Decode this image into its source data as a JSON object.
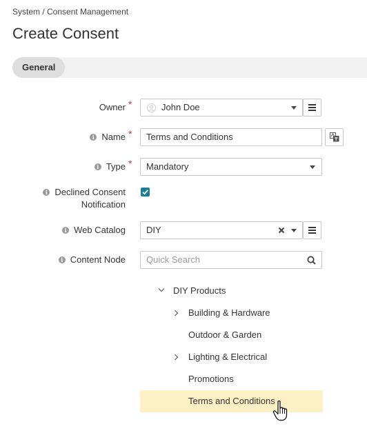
{
  "breadcrumb": "System / Consent Management",
  "page_title": "Create Consent",
  "tabs": [
    {
      "label": "General"
    }
  ],
  "form": {
    "owner": {
      "label": "Owner",
      "value": "John Doe"
    },
    "name": {
      "label": "Name",
      "value": "Terms and Conditions"
    },
    "type": {
      "label": "Type",
      "value": "Mandatory"
    },
    "declined": {
      "label_line1": "Declined Consent",
      "label_line2": "Notification",
      "checked": true
    },
    "web_catalog": {
      "label": "Web Catalog",
      "value": "DIY"
    },
    "content_node": {
      "label": "Content Node",
      "placeholder": "Quick Search"
    }
  },
  "tree": {
    "root": "DIY Products",
    "children": [
      {
        "label": "Building & Hardware",
        "expandable": true
      },
      {
        "label": "Outdoor & Garden",
        "expandable": false
      },
      {
        "label": "Lighting & Electrical",
        "expandable": true
      },
      {
        "label": "Promotions",
        "expandable": false
      },
      {
        "label": "Terms and Conditions",
        "expandable": false,
        "selected": true
      }
    ]
  },
  "colors": {
    "accent": "#1a7f96",
    "required": "#cc3333",
    "selected_row": "#fdf0c4"
  }
}
